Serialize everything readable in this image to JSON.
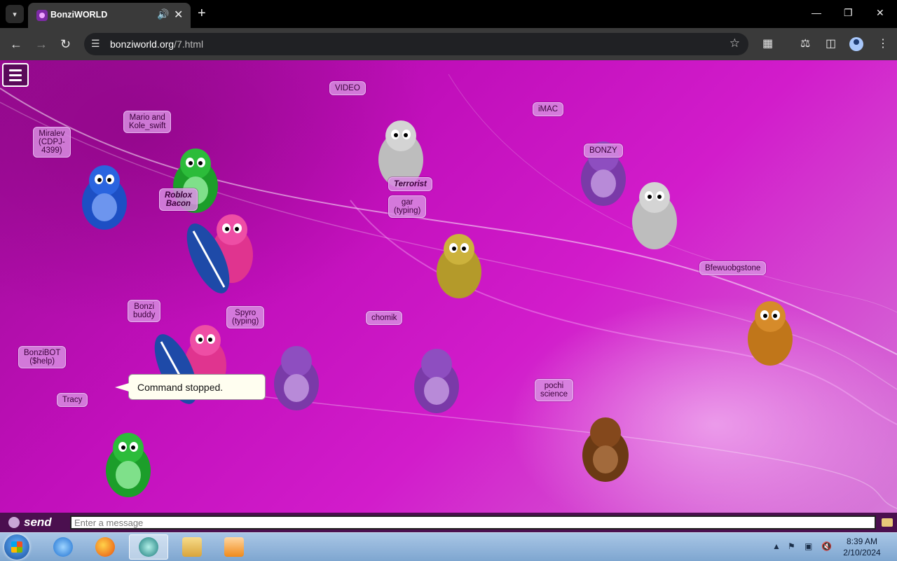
{
  "browser": {
    "tab_title": "BonziWORLD",
    "url_domain": "bonziworld.org",
    "url_path": "/7.html",
    "icons": [
      "tab-search-icon",
      "audio-icon",
      "close-icon",
      "plus-icon",
      "minimize-icon",
      "restore-icon",
      "close-window-icon",
      "back-arrow-icon",
      "forward-arrow-icon",
      "reload-icon",
      "site-info-icon",
      "star-icon",
      "extensions-icon",
      "labs-icon",
      "side-panel-icon",
      "profile-icon",
      "kebab-menu-icon"
    ]
  },
  "page": {
    "users": [
      {
        "name": "VIDEO"
      },
      {
        "name": "iMAC"
      },
      {
        "name": "Mario and\nKole_swift"
      },
      {
        "name": "Miralev\n(CDPJ-\n4399)"
      },
      {
        "name": "BONZY"
      },
      {
        "name": "Roblox\nBacon"
      },
      {
        "name": "Terrorist"
      },
      {
        "name": "gar\n(typing)"
      },
      {
        "name": "Bfewuobgstone"
      },
      {
        "name": "Bonzi\nbuddy"
      },
      {
        "name": "Spyro\n(typing)"
      },
      {
        "name": "chomik"
      },
      {
        "name": "BonziBOT\n($help)"
      },
      {
        "name": "Tracy"
      },
      {
        "name": "pochi\nscience"
      }
    ],
    "speech_bubble": "Command stopped.",
    "colors": {
      "background": "#c10fbb",
      "accent": "#4b0f4f"
    }
  },
  "chat": {
    "send_label": "send",
    "input_placeholder": "Enter a message",
    "input_value": ""
  },
  "taskbar": {
    "apps": [
      "internet-explorer-icon",
      "firefox-icon",
      "bonziworld-app-icon",
      "file-explorer-icon",
      "media-player-icon"
    ],
    "clock_time": "8:39 AM",
    "clock_date": "2/10/2024"
  }
}
